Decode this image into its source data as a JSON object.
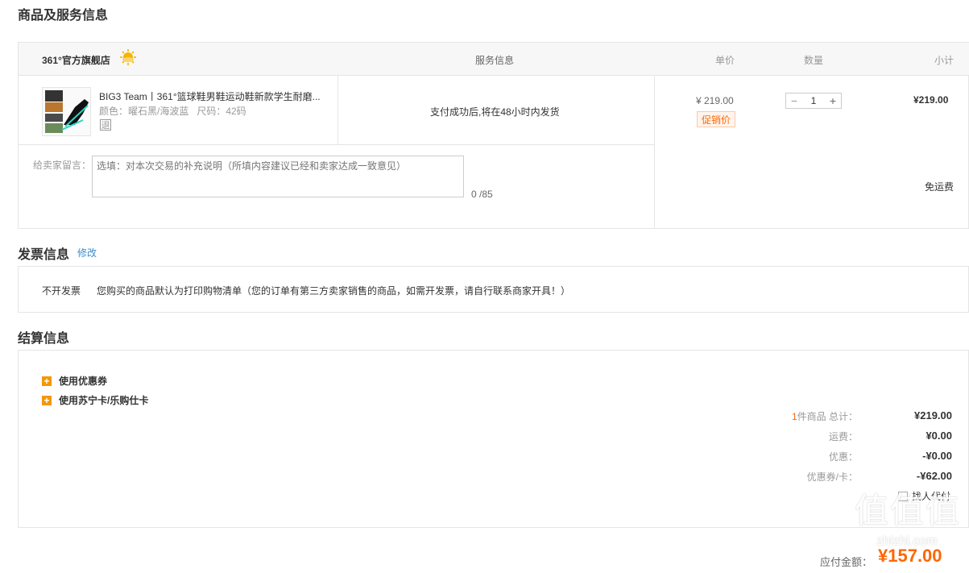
{
  "section_goods_title": "商品及服务信息",
  "table_header": {
    "store_name": "361°官方旗舰店",
    "service_info": "服务信息",
    "unit_price": "单价",
    "quantity": "数量",
    "subtotal": "小计"
  },
  "item": {
    "name": "BIG3 Team丨361°篮球鞋男鞋运动鞋新款学生耐磨...",
    "attrs": "颜色：曜石黑/海波蓝   尺码：42码",
    "return_badge": "退",
    "service_text": "支付成功后,将在48小时内发货",
    "price": "¥ 219.00",
    "promo_tag": "促销价",
    "qty": "1",
    "qty_minus": "−",
    "qty_plus": "+",
    "subtotal": "¥219.00"
  },
  "message": {
    "label": "给卖家留言：",
    "placeholder": "选填：对本次交易的补充说明（所填内容建议已经和卖家达成一致意见）",
    "counter": "0 /85",
    "shipping": "免运费"
  },
  "invoice": {
    "title": "发票信息",
    "edit_link": "修改",
    "type": "不开发票",
    "note": "您购买的商品默认为打印购物清单（您的订单有第三方卖家销售的商品，如需开发票，请自行联系商家开具！）"
  },
  "settlement": {
    "title": "结算信息",
    "coupon_toggle": "使用优惠券",
    "card_toggle": "使用苏宁卡/乐购仕卡",
    "count_num": "1",
    "count_label": "件商品 总计：",
    "total": "¥219.00",
    "shipping_label": "运费：",
    "shipping_value": "¥0.00",
    "discount_label": "优惠：",
    "discount_value": "-¥0.00",
    "coupon_label": "优惠券/卡：",
    "coupon_value": "-¥62.00",
    "proxy_pay": "找人代付",
    "payable_label": "应付金额：",
    "payable_value": "¥157.00"
  },
  "watermark": {
    "logo_text": "值",
    "domain": "zhizhi.com"
  },
  "colors": {
    "accent": "#ff6600",
    "link": "#3a8ccf",
    "border": "#e5e5e5",
    "plus_icon": "#f39800"
  }
}
